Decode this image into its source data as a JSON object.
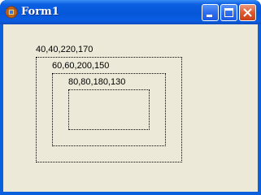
{
  "window": {
    "title": "Form1",
    "controls": {
      "minimize_icon": "minimize-icon",
      "maximize_icon": "maximize-icon",
      "close_icon": "close-icon"
    }
  },
  "colors": {
    "titlebar": "#0a5fe0",
    "client_background": "#ece9d8",
    "close_button": "#e0582e"
  },
  "client": {
    "rectangles": [
      {
        "label": "40,40,220,170"
      },
      {
        "label": "60,60,200,150"
      },
      {
        "label": "80,80,180,130"
      }
    ]
  }
}
